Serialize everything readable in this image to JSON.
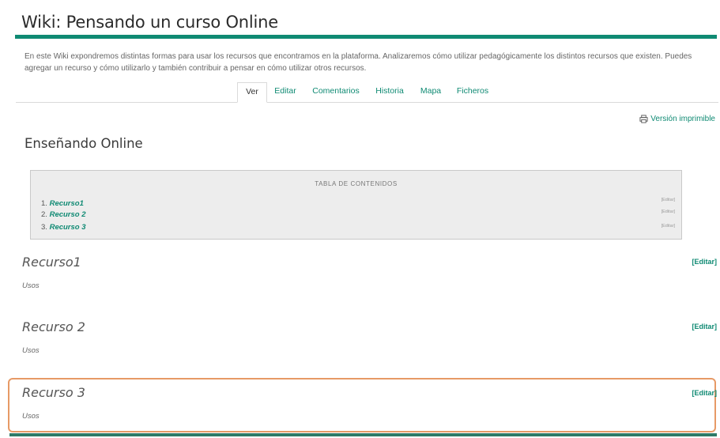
{
  "page": {
    "title": "Wiki: Pensando un curso Online",
    "intro": "En este Wiki expondremos distintas formas para usar los recursos que encontramos en la plataforma. Analizaremos cómo utilizar pedagógicamente los distintos recursos que existen. Puedes agregar un recurso y cómo utilizarlo y también contribuir a pensar en cómo utilizar otros recursos.",
    "accent_color": "#0f8a73"
  },
  "tabs": [
    {
      "label": "Ver",
      "active": true
    },
    {
      "label": "Editar",
      "active": false
    },
    {
      "label": "Comentarios",
      "active": false
    },
    {
      "label": "Historia",
      "active": false
    },
    {
      "label": "Mapa",
      "active": false
    },
    {
      "label": "Ficheros",
      "active": false
    }
  ],
  "print_link": {
    "label": "Versión imprimible",
    "icon": "printer-icon"
  },
  "main_heading": "Enseñando Online",
  "toc": {
    "title": "Tabla de contenidos",
    "items": [
      {
        "number": "1.",
        "label": "Recurso1",
        "edit": "[Editar]"
      },
      {
        "number": "2.",
        "label": "Recurso 2",
        "edit": "[Editar]"
      },
      {
        "number": "3.",
        "label": "Recurso 3",
        "edit": "[Editar]"
      }
    ]
  },
  "sections": [
    {
      "title": "Recurso1",
      "body": "Usos",
      "edit": "[Editar]"
    },
    {
      "title": "Recurso 2",
      "body": "Usos",
      "edit": "[Editar]"
    },
    {
      "title": "Recurso 3",
      "body": "Usos",
      "edit": "[Editar]",
      "highlighted": true
    }
  ],
  "highlight_color": "#e79a66"
}
